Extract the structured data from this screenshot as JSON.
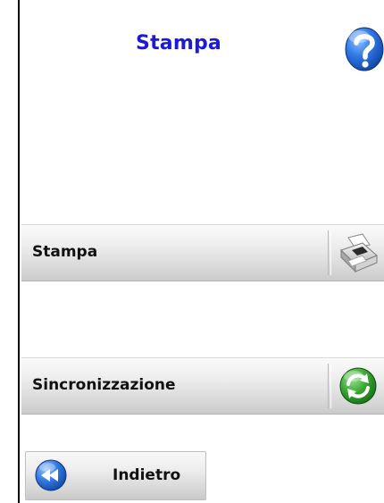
{
  "header": {
    "title": "Stampa",
    "help_icon": "help-question-icon"
  },
  "actions": [
    {
      "label": "Stampa",
      "icon": "printer-icon"
    },
    {
      "label": "Sincronizzazione",
      "icon": "sync-refresh-icon"
    }
  ],
  "footer": {
    "back_label": "Indietro",
    "back_icon": "rewind-back-icon"
  },
  "colors": {
    "title": "#1d1ad6",
    "help_blue": "#1b5fd6",
    "sync_green": "#2f9a2a",
    "back_blue": "#2a6fdc"
  }
}
